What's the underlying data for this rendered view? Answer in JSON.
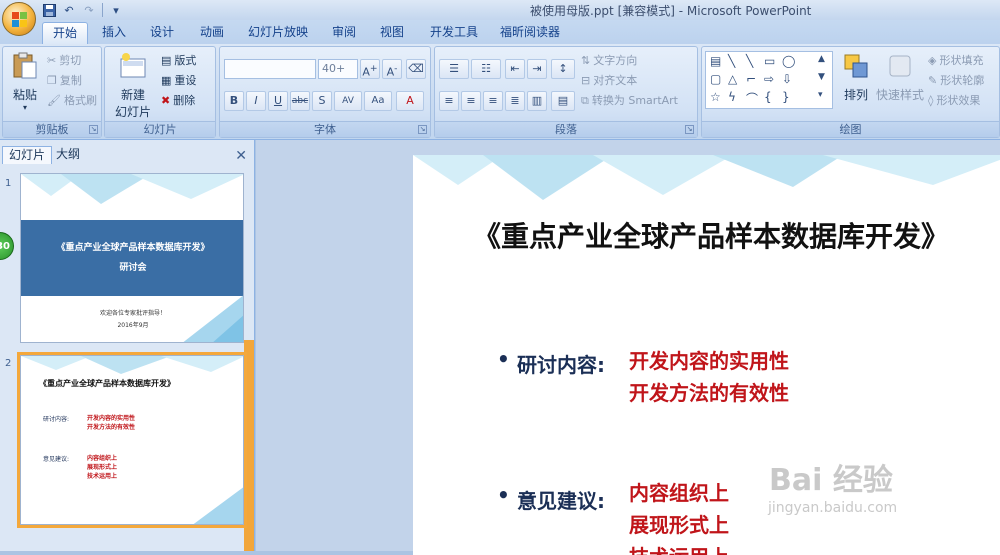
{
  "window": {
    "title": "被使用母版.ppt [兼容模式] - Microsoft PowerPoint"
  },
  "tabs": [
    {
      "label": "开始"
    },
    {
      "label": "插入"
    },
    {
      "label": "设计"
    },
    {
      "label": "动画"
    },
    {
      "label": "幻灯片放映"
    },
    {
      "label": "审阅"
    },
    {
      "label": "视图"
    },
    {
      "label": "开发工具"
    },
    {
      "label": "福昕阅读器"
    }
  ],
  "ribbon": {
    "clipboard": {
      "paste": "粘贴",
      "cut": "剪切",
      "copy": "复制",
      "format_painter": "格式刷",
      "label": "剪贴板"
    },
    "slides": {
      "new_slide": "新建",
      "new_slide2": "幻灯片",
      "layout": "版式",
      "reset": "重设",
      "delete": "删除",
      "label": "幻灯片"
    },
    "font": {
      "font_name": "",
      "font_size": "40+",
      "label": "字体"
    },
    "paragraph": {
      "text_direction": "文字方向",
      "align_text": "对齐文本",
      "smartart": "转换为 SmartArt",
      "label": "段落"
    },
    "drawing": {
      "arrange": "排列",
      "quick_styles": "快速样式",
      "fill": "形状填充",
      "outline": "形状轮廓",
      "effects": "形状效果",
      "label": "绘图"
    }
  },
  "left_pane": {
    "tab_slides": "幻灯片",
    "tab_outline": "大纲",
    "badge": "30",
    "slide1": {
      "num": "1",
      "title": "《重点产业全球产品样本数据库开发》",
      "subtitle": "研讨会",
      "footer1": "欢迎各位专家批评指导！",
      "footer2": "2016年9月"
    },
    "slide2": {
      "num": "2",
      "title": "《重点产业全球产品样本数据库开发》",
      "label1": "研讨内容:",
      "r1": "开发内容的实用性",
      "r2": "开发方法的有效性",
      "label2": "意见建议:",
      "r3": "内容组织上",
      "r4": "展现形式上",
      "r5": "技术运用上"
    }
  },
  "slide": {
    "title": "《重点产业全球产品样本数据库开发》",
    "label1": "研讨内容:",
    "r1": "开发内容的实用性",
    "r2": "开发方法的有效性",
    "label2": "意见建议:",
    "r3": "内容组织上",
    "r4": "展现形式上",
    "r5": "技术运用上",
    "watermark": "Bai 经验",
    "watermark_url": "jingyan.baidu.com"
  }
}
